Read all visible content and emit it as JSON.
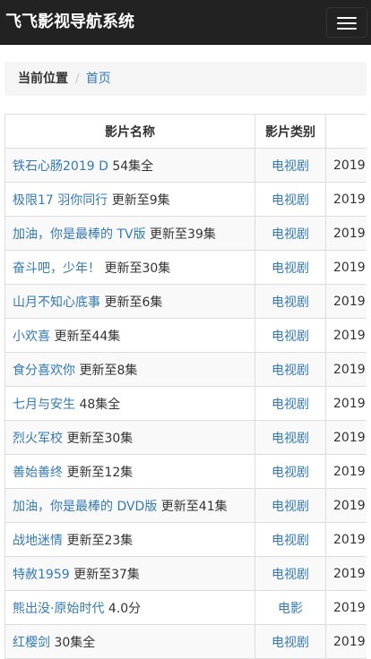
{
  "navbar": {
    "brand": "飞飞影视导航系统",
    "toggle_icon": "hamburger-menu-icon"
  },
  "breadcrumb": {
    "current_label": "当前位置",
    "separator": "/",
    "home_label": "首页"
  },
  "table": {
    "headers": [
      "影片名称",
      "影片类别",
      ""
    ],
    "rows": [
      {
        "title": "铁石心肠2019 D",
        "status": "54集全",
        "category": "电视剧",
        "year": "2019"
      },
      {
        "title": "极限17 羽你同行",
        "status": "更新至9集",
        "category": "电视剧",
        "year": "2019"
      },
      {
        "title": "加油，你是最棒的 TV版",
        "status": "更新至39集",
        "category": "电视剧",
        "year": "2019"
      },
      {
        "title": "奋斗吧，少年！",
        "status": "更新至30集",
        "category": "电视剧",
        "year": "2019"
      },
      {
        "title": "山月不知心底事",
        "status": "更新至6集",
        "category": "电视剧",
        "year": "2019"
      },
      {
        "title": "小欢喜",
        "status": "更新至44集",
        "category": "电视剧",
        "year": "2019"
      },
      {
        "title": "食分喜欢你",
        "status": "更新至8集",
        "category": "电视剧",
        "year": "2019"
      },
      {
        "title": "七月与安生",
        "status": "48集全",
        "category": "电视剧",
        "year": "2019"
      },
      {
        "title": "烈火军校",
        "status": "更新至30集",
        "category": "电视剧",
        "year": "2019"
      },
      {
        "title": "善始善终",
        "status": "更新至12集",
        "category": "电视剧",
        "year": "2019"
      },
      {
        "title": "加油，你是最棒的 DVD版",
        "status": "更新至41集",
        "category": "电视剧",
        "year": "2019"
      },
      {
        "title": "战地迷情",
        "status": "更新至23集",
        "category": "电视剧",
        "year": "2019"
      },
      {
        "title": "特赦1959",
        "status": "更新至37集",
        "category": "电视剧",
        "year": "2019"
      },
      {
        "title": "熊出没·原始时代",
        "status": "4.0分",
        "category": "电影",
        "year": "2019"
      },
      {
        "title": "红樱剑",
        "status": "30集全",
        "category": "电视剧",
        "year": "2019"
      }
    ]
  },
  "colors": {
    "navbar_bg": "#222222",
    "link": "#337ab7",
    "breadcrumb_bg": "#f5f5f5",
    "stripe": "#f9f9f9"
  }
}
